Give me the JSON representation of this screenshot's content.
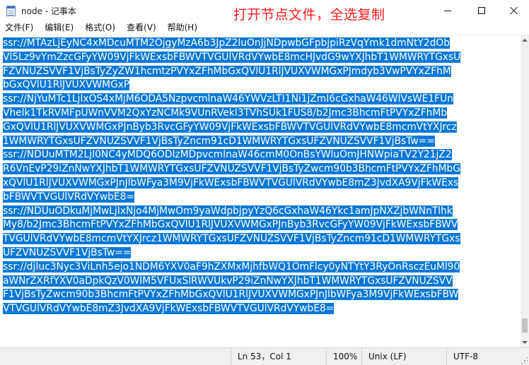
{
  "window": {
    "title": "node - 记事本",
    "icon": "notepad-icon",
    "annotation": "打开节点文件，全选复制",
    "annotation_color": "#ff1a1a"
  },
  "menu": {
    "items": [
      {
        "label": "文件(F)"
      },
      {
        "label": "编辑(E)"
      },
      {
        "label": "格式(O)"
      },
      {
        "label": "查看(V)"
      },
      {
        "label": "帮助(H)"
      }
    ]
  },
  "editor": {
    "selection_color": "#0a78d7",
    "lines": [
      "ssr://MTAzLjEyNC4xMDcuMTM2OjgyMzA6b3JpZ2luOnJjNDpwbGFpbjpiRzVqYmk1dmNtY2dOb",
      "Vl5Lz9vYmZzcGFyYW09VjFkWExsbFBWVTVGUlVRdVYwbE8mcHJvdG9wYXJhbT1WMWRYTGxsU",
      "FZVNUZSVVF1VjBsTyZyZW1hcmtzPVYxZFhMbGxQVlU1RlJVUXVWMGxPJmdyb3VwPVYxZFhM",
      "bGxQVlU1RlJVUXVWMGxP",
      "ssr://NjYuMTc1LjIxOS4xMjM6ODA5NzpvcmlnaW46YWVzLTI1Ni1jZmI6cGxhaW46WlVsWE1FUn",
      "Vhelk1TkRVMFpUWnVVM2QxYzNCMk9VUnRVekl3TVhSUk1FUS8/b2Jmc3BhcmFtPVYxZFhMb",
      "GxQVlU1RlJVUXVWMGxPJnByb3RvcGFyYW09VjFkWExsbFBWVTVGUlVRdVYwbE8mcmVtYXJrcz",
      "1WMWRYTGxsUFZVNUZSVVF1VjBsTyZncm91cD1WMWRYTGxsUFZVNUZSVVF1VjBsTw==",
      "ssr://NDUuMTM2LjI0NC4yMDQ6ODIzMDpvcmlnaW46cmM0OnBsYWluOmJHNWpiaTV2Y21jZ2",
      "R6VnEvP29iZnNwYXJhbT1WMWRYTGxsUFZVNUZSVVF1VjBsTyZwcm90b3BhcmFtPVYxZFhMbG",
      "xQVlU1RlJVUXVWMGxPJnJlbWFya3M9VjFkWExsbFBWVTVGUlVRdVYwbE8mZ3JvdXA9VjFkWExs",
      "bFBWVTVGUlVRdVYwbE8=",
      "ssr://NDUuODkuMjMwLjIxNjo4MjMwOm9yaWdpbjpyYzQ6cGxhaW46Ykc1amJpNXZjbWNnTlhk",
      "My8/b2Jmc3BhcmFtPVYxZFhMbGxQVlU1RlJVUXVWMGxPJnByb3RvcGFyYW09VjFkWExsbFBWV",
      "TVGUlVRdVYwbE8mcmVtYXJrcz1WMWRYTGxsUFZVNUZSVVF1VjBsTyZncm91cD1WMWRYTGxs",
      "UFZVNUZSVVF1VjBsTw==",
      "ssr://djIuc3Nyc3ViLnh5ejo1NDM6YXV0aF9hZXMxMjhfbWQ1OmFlcy0yNTYtY3RyOnRsczEuMl90",
      "aWNrZXRfYXV0aDpkQzV0WlM5VFUxSlRWVUkvP29iZnNwYXJhbT1WMWRYTGxsUFZVNUZSVV",
      "F1VjBsTyZwcm90b3BhcmFtPVYxZFhMbGxQVlU1RlJVUXVWMGxPJnJlbWFya3M9VjFkWExsbFBW",
      "VTVGUlVRdVYwbE8mZ3JvdXA9VjFkWExsbFBWVTVGUlVRdVYwbE8="
    ]
  },
  "statusbar": {
    "position": "Ln 53，Col 1",
    "zoom": "100%",
    "line_ending": "Unix (LF)",
    "encoding": "UTF-8"
  }
}
